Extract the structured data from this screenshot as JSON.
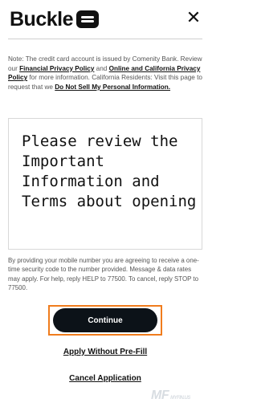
{
  "header": {
    "logo_text": "Buckle",
    "close_label": "✕"
  },
  "note": {
    "p1": "Note: The credit card account is issued by Comenity Bank. Review our ",
    "link_financial": "Financial Privacy Policy",
    "p2": " and ",
    "link_online": "Online and California Privacy Policy",
    "p3": " for more information. California Residents: Visit this page to request that we ",
    "link_do_not_sell": "Do Not Sell My Personal Information."
  },
  "terms": {
    "text": "Please review the Important Information and Terms about opening"
  },
  "consent": {
    "text": "By providing your mobile number you are agreeing to receive a one-time security code to the number provided. Message & data rates may apply. For help, reply HELP to 77500. To cancel, reply STOP to 77500."
  },
  "actions": {
    "continue_label": "Continue",
    "apply_without_label": "Apply Without Pre-Fill",
    "cancel_label": "Cancel Application"
  },
  "watermark": {
    "text": "MF",
    "sub": "MYFIN.US"
  },
  "colors": {
    "accent_focus": "#f07c1d",
    "button_bg": "#0c1218"
  }
}
